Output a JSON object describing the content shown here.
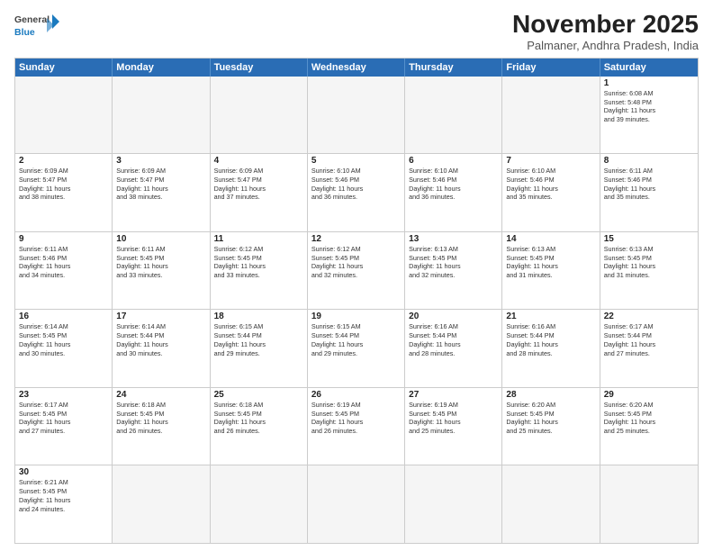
{
  "header": {
    "logo_general": "General",
    "logo_blue": "Blue",
    "month_title": "November 2025",
    "location": "Palmaner, Andhra Pradesh, India"
  },
  "day_headers": [
    "Sunday",
    "Monday",
    "Tuesday",
    "Wednesday",
    "Thursday",
    "Friday",
    "Saturday"
  ],
  "rows": [
    [
      {
        "day": "",
        "info": ""
      },
      {
        "day": "",
        "info": ""
      },
      {
        "day": "",
        "info": ""
      },
      {
        "day": "",
        "info": ""
      },
      {
        "day": "",
        "info": ""
      },
      {
        "day": "",
        "info": ""
      },
      {
        "day": "1",
        "info": "Sunrise: 6:08 AM\nSunset: 5:48 PM\nDaylight: 11 hours\nand 39 minutes."
      }
    ],
    [
      {
        "day": "2",
        "info": "Sunrise: 6:09 AM\nSunset: 5:47 PM\nDaylight: 11 hours\nand 38 minutes."
      },
      {
        "day": "3",
        "info": "Sunrise: 6:09 AM\nSunset: 5:47 PM\nDaylight: 11 hours\nand 38 minutes."
      },
      {
        "day": "4",
        "info": "Sunrise: 6:09 AM\nSunset: 5:47 PM\nDaylight: 11 hours\nand 37 minutes."
      },
      {
        "day": "5",
        "info": "Sunrise: 6:10 AM\nSunset: 5:46 PM\nDaylight: 11 hours\nand 36 minutes."
      },
      {
        "day": "6",
        "info": "Sunrise: 6:10 AM\nSunset: 5:46 PM\nDaylight: 11 hours\nand 36 minutes."
      },
      {
        "day": "7",
        "info": "Sunrise: 6:10 AM\nSunset: 5:46 PM\nDaylight: 11 hours\nand 35 minutes."
      },
      {
        "day": "8",
        "info": "Sunrise: 6:11 AM\nSunset: 5:46 PM\nDaylight: 11 hours\nand 35 minutes."
      }
    ],
    [
      {
        "day": "9",
        "info": "Sunrise: 6:11 AM\nSunset: 5:46 PM\nDaylight: 11 hours\nand 34 minutes."
      },
      {
        "day": "10",
        "info": "Sunrise: 6:11 AM\nSunset: 5:45 PM\nDaylight: 11 hours\nand 33 minutes."
      },
      {
        "day": "11",
        "info": "Sunrise: 6:12 AM\nSunset: 5:45 PM\nDaylight: 11 hours\nand 33 minutes."
      },
      {
        "day": "12",
        "info": "Sunrise: 6:12 AM\nSunset: 5:45 PM\nDaylight: 11 hours\nand 32 minutes."
      },
      {
        "day": "13",
        "info": "Sunrise: 6:13 AM\nSunset: 5:45 PM\nDaylight: 11 hours\nand 32 minutes."
      },
      {
        "day": "14",
        "info": "Sunrise: 6:13 AM\nSunset: 5:45 PM\nDaylight: 11 hours\nand 31 minutes."
      },
      {
        "day": "15",
        "info": "Sunrise: 6:13 AM\nSunset: 5:45 PM\nDaylight: 11 hours\nand 31 minutes."
      }
    ],
    [
      {
        "day": "16",
        "info": "Sunrise: 6:14 AM\nSunset: 5:45 PM\nDaylight: 11 hours\nand 30 minutes."
      },
      {
        "day": "17",
        "info": "Sunrise: 6:14 AM\nSunset: 5:44 PM\nDaylight: 11 hours\nand 30 minutes."
      },
      {
        "day": "18",
        "info": "Sunrise: 6:15 AM\nSunset: 5:44 PM\nDaylight: 11 hours\nand 29 minutes."
      },
      {
        "day": "19",
        "info": "Sunrise: 6:15 AM\nSunset: 5:44 PM\nDaylight: 11 hours\nand 29 minutes."
      },
      {
        "day": "20",
        "info": "Sunrise: 6:16 AM\nSunset: 5:44 PM\nDaylight: 11 hours\nand 28 minutes."
      },
      {
        "day": "21",
        "info": "Sunrise: 6:16 AM\nSunset: 5:44 PM\nDaylight: 11 hours\nand 28 minutes."
      },
      {
        "day": "22",
        "info": "Sunrise: 6:17 AM\nSunset: 5:44 PM\nDaylight: 11 hours\nand 27 minutes."
      }
    ],
    [
      {
        "day": "23",
        "info": "Sunrise: 6:17 AM\nSunset: 5:45 PM\nDaylight: 11 hours\nand 27 minutes."
      },
      {
        "day": "24",
        "info": "Sunrise: 6:18 AM\nSunset: 5:45 PM\nDaylight: 11 hours\nand 26 minutes."
      },
      {
        "day": "25",
        "info": "Sunrise: 6:18 AM\nSunset: 5:45 PM\nDaylight: 11 hours\nand 26 minutes."
      },
      {
        "day": "26",
        "info": "Sunrise: 6:19 AM\nSunset: 5:45 PM\nDaylight: 11 hours\nand 26 minutes."
      },
      {
        "day": "27",
        "info": "Sunrise: 6:19 AM\nSunset: 5:45 PM\nDaylight: 11 hours\nand 25 minutes."
      },
      {
        "day": "28",
        "info": "Sunrise: 6:20 AM\nSunset: 5:45 PM\nDaylight: 11 hours\nand 25 minutes."
      },
      {
        "day": "29",
        "info": "Sunrise: 6:20 AM\nSunset: 5:45 PM\nDaylight: 11 hours\nand 25 minutes."
      }
    ],
    [
      {
        "day": "30",
        "info": "Sunrise: 6:21 AM\nSunset: 5:45 PM\nDaylight: 11 hours\nand 24 minutes."
      },
      {
        "day": "",
        "info": ""
      },
      {
        "day": "",
        "info": ""
      },
      {
        "day": "",
        "info": ""
      },
      {
        "day": "",
        "info": ""
      },
      {
        "day": "",
        "info": ""
      },
      {
        "day": "",
        "info": ""
      }
    ]
  ]
}
